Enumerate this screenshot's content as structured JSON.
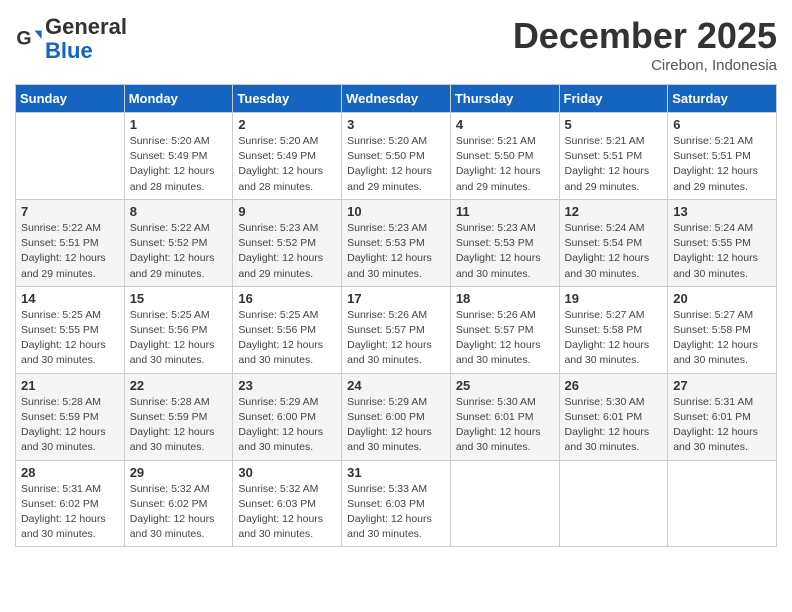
{
  "header": {
    "logo_line1": "General",
    "logo_line2": "Blue",
    "month": "December 2025",
    "location": "Cirebon, Indonesia"
  },
  "weekdays": [
    "Sunday",
    "Monday",
    "Tuesday",
    "Wednesday",
    "Thursday",
    "Friday",
    "Saturday"
  ],
  "weeks": [
    [
      {
        "day": "",
        "info": ""
      },
      {
        "day": "1",
        "info": "Sunrise: 5:20 AM\nSunset: 5:49 PM\nDaylight: 12 hours\nand 28 minutes."
      },
      {
        "day": "2",
        "info": "Sunrise: 5:20 AM\nSunset: 5:49 PM\nDaylight: 12 hours\nand 28 minutes."
      },
      {
        "day": "3",
        "info": "Sunrise: 5:20 AM\nSunset: 5:50 PM\nDaylight: 12 hours\nand 29 minutes."
      },
      {
        "day": "4",
        "info": "Sunrise: 5:21 AM\nSunset: 5:50 PM\nDaylight: 12 hours\nand 29 minutes."
      },
      {
        "day": "5",
        "info": "Sunrise: 5:21 AM\nSunset: 5:51 PM\nDaylight: 12 hours\nand 29 minutes."
      },
      {
        "day": "6",
        "info": "Sunrise: 5:21 AM\nSunset: 5:51 PM\nDaylight: 12 hours\nand 29 minutes."
      }
    ],
    [
      {
        "day": "7",
        "info": "Sunrise: 5:22 AM\nSunset: 5:51 PM\nDaylight: 12 hours\nand 29 minutes."
      },
      {
        "day": "8",
        "info": "Sunrise: 5:22 AM\nSunset: 5:52 PM\nDaylight: 12 hours\nand 29 minutes."
      },
      {
        "day": "9",
        "info": "Sunrise: 5:23 AM\nSunset: 5:52 PM\nDaylight: 12 hours\nand 29 minutes."
      },
      {
        "day": "10",
        "info": "Sunrise: 5:23 AM\nSunset: 5:53 PM\nDaylight: 12 hours\nand 30 minutes."
      },
      {
        "day": "11",
        "info": "Sunrise: 5:23 AM\nSunset: 5:53 PM\nDaylight: 12 hours\nand 30 minutes."
      },
      {
        "day": "12",
        "info": "Sunrise: 5:24 AM\nSunset: 5:54 PM\nDaylight: 12 hours\nand 30 minutes."
      },
      {
        "day": "13",
        "info": "Sunrise: 5:24 AM\nSunset: 5:55 PM\nDaylight: 12 hours\nand 30 minutes."
      }
    ],
    [
      {
        "day": "14",
        "info": "Sunrise: 5:25 AM\nSunset: 5:55 PM\nDaylight: 12 hours\nand 30 minutes."
      },
      {
        "day": "15",
        "info": "Sunrise: 5:25 AM\nSunset: 5:56 PM\nDaylight: 12 hours\nand 30 minutes."
      },
      {
        "day": "16",
        "info": "Sunrise: 5:25 AM\nSunset: 5:56 PM\nDaylight: 12 hours\nand 30 minutes."
      },
      {
        "day": "17",
        "info": "Sunrise: 5:26 AM\nSunset: 5:57 PM\nDaylight: 12 hours\nand 30 minutes."
      },
      {
        "day": "18",
        "info": "Sunrise: 5:26 AM\nSunset: 5:57 PM\nDaylight: 12 hours\nand 30 minutes."
      },
      {
        "day": "19",
        "info": "Sunrise: 5:27 AM\nSunset: 5:58 PM\nDaylight: 12 hours\nand 30 minutes."
      },
      {
        "day": "20",
        "info": "Sunrise: 5:27 AM\nSunset: 5:58 PM\nDaylight: 12 hours\nand 30 minutes."
      }
    ],
    [
      {
        "day": "21",
        "info": "Sunrise: 5:28 AM\nSunset: 5:59 PM\nDaylight: 12 hours\nand 30 minutes."
      },
      {
        "day": "22",
        "info": "Sunrise: 5:28 AM\nSunset: 5:59 PM\nDaylight: 12 hours\nand 30 minutes."
      },
      {
        "day": "23",
        "info": "Sunrise: 5:29 AM\nSunset: 6:00 PM\nDaylight: 12 hours\nand 30 minutes."
      },
      {
        "day": "24",
        "info": "Sunrise: 5:29 AM\nSunset: 6:00 PM\nDaylight: 12 hours\nand 30 minutes."
      },
      {
        "day": "25",
        "info": "Sunrise: 5:30 AM\nSunset: 6:01 PM\nDaylight: 12 hours\nand 30 minutes."
      },
      {
        "day": "26",
        "info": "Sunrise: 5:30 AM\nSunset: 6:01 PM\nDaylight: 12 hours\nand 30 minutes."
      },
      {
        "day": "27",
        "info": "Sunrise: 5:31 AM\nSunset: 6:01 PM\nDaylight: 12 hours\nand 30 minutes."
      }
    ],
    [
      {
        "day": "28",
        "info": "Sunrise: 5:31 AM\nSunset: 6:02 PM\nDaylight: 12 hours\nand 30 minutes."
      },
      {
        "day": "29",
        "info": "Sunrise: 5:32 AM\nSunset: 6:02 PM\nDaylight: 12 hours\nand 30 minutes."
      },
      {
        "day": "30",
        "info": "Sunrise: 5:32 AM\nSunset: 6:03 PM\nDaylight: 12 hours\nand 30 minutes."
      },
      {
        "day": "31",
        "info": "Sunrise: 5:33 AM\nSunset: 6:03 PM\nDaylight: 12 hours\nand 30 minutes."
      },
      {
        "day": "",
        "info": ""
      },
      {
        "day": "",
        "info": ""
      },
      {
        "day": "",
        "info": ""
      }
    ]
  ]
}
